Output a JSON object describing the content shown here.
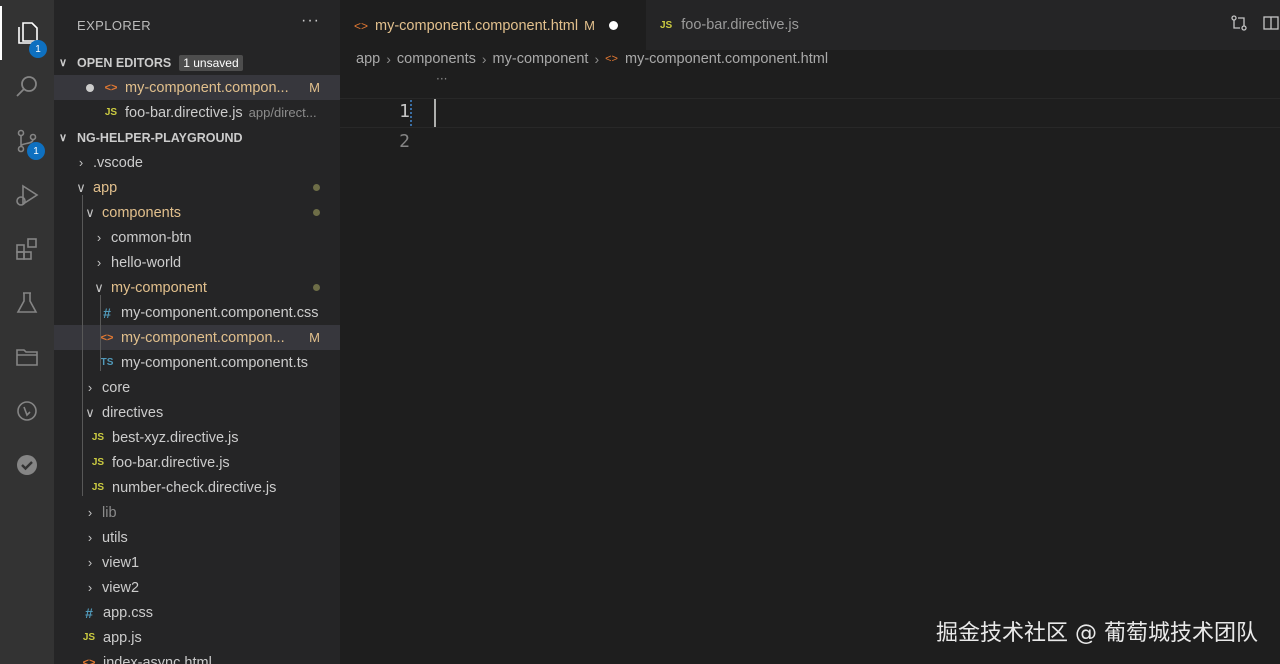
{
  "activity_bar": {
    "explorer_badge": "1",
    "scm_badge": "1"
  },
  "sidebar": {
    "title": "EXPLORER",
    "more": "···",
    "open_editors": {
      "title": "OPEN EDITORS",
      "badge": "1 unsaved",
      "items": [
        {
          "name": "my-component.compon...",
          "flag": "M"
        },
        {
          "name": "foo-bar.directive.js",
          "path": "app/direct..."
        }
      ]
    },
    "workspace": {
      "title": "NG-HELPER-PLAYGROUND",
      "tree": {
        "vscode": ".vscode",
        "app": "app",
        "components": "components",
        "common_btn": "common-btn",
        "hello_world": "hello-world",
        "my_component": "my-component",
        "css_file": "my-component.component.css",
        "html_file": "my-component.compon...",
        "html_flag": "M",
        "ts_file": "my-component.component.ts",
        "core": "core",
        "directives": "directives",
        "best_xyz": "best-xyz.directive.js",
        "foo_bar": "foo-bar.directive.js",
        "number_check": "number-check.directive.js",
        "lib": "lib",
        "utils": "utils",
        "view1": "view1",
        "view2": "view2",
        "app_css": "app.css",
        "app_js": "app.js",
        "index_async": "index-async.html"
      }
    }
  },
  "tabs": [
    {
      "label": "my-component.component.html",
      "flag": "M"
    },
    {
      "label": "foo-bar.directive.js"
    }
  ],
  "breadcrumb": [
    "app",
    "components",
    "my-component",
    "my-component.component.html"
  ],
  "editor": {
    "ellipsis": "···",
    "line_numbers": [
      "1",
      "2"
    ]
  },
  "watermark": "掘金技术社区 @ 葡萄城技术团队",
  "colors": {
    "modified": "#e2c08d",
    "badge": "#0e70c0",
    "html_icon": "#e37933",
    "js_icon": "#cbcb41",
    "ts_icon": "#519aba"
  }
}
